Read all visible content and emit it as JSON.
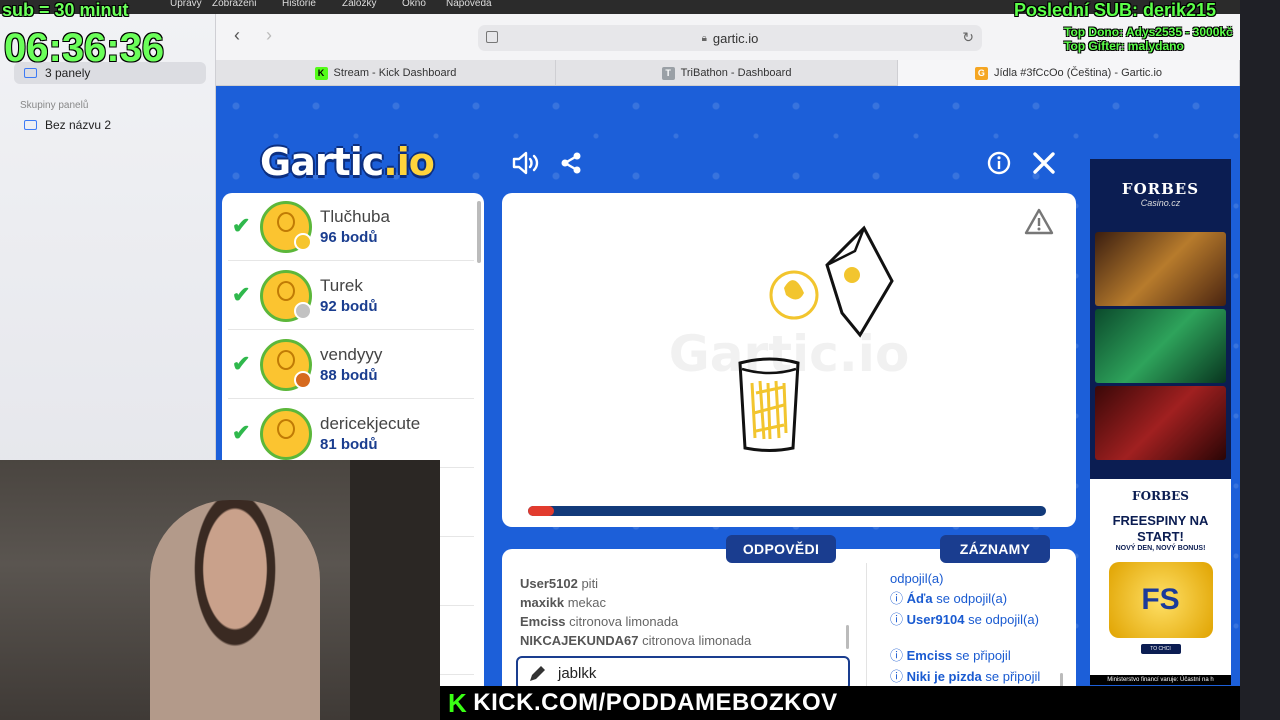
{
  "overlay": {
    "sub_rule": "sub = 30 minut",
    "timer": "06:36:36",
    "last_sub": "Poslední SUB: derik215",
    "top_donor": "Top Dono: Adys2535 - 3000kč",
    "top_gifter": "Top Gifter: malydano",
    "channel_url": "KICK.COM/PODDAMEBOZKOV",
    "kick_logo": "K"
  },
  "menubar": {
    "items": [
      "Upravy",
      "Zobrazeni",
      "Historie",
      "Zalozky",
      "Okno",
      "Napoveda"
    ]
  },
  "browser": {
    "sidebar": {
      "current": "3 panely",
      "section_label": "Skupiny panelů",
      "groups": [
        "Bez názvu 2"
      ]
    },
    "url": "gartic.io",
    "back_icon": "chevron-left-icon",
    "forward_icon": "chevron-right-icon",
    "tabs": [
      {
        "title": "Stream - Kick Dashboard",
        "favicon": "K",
        "favicon_color": "#53fc18"
      },
      {
        "title": "TriBathon - Dashboard",
        "favicon": "T",
        "favicon_color": "#9aa0a6"
      },
      {
        "title": "Jídla #3fCcOo (Čeština) - Gartic.io",
        "favicon": "G",
        "favicon_color": "#f5a623"
      }
    ]
  },
  "gartic": {
    "logo_main": "Gartic",
    "logo_suffix": ".io",
    "players": [
      {
        "name": "Tlučhuba",
        "score": "96 bodů",
        "medal": "#f6c52c"
      },
      {
        "name": "Turek",
        "score": "92 bodů",
        "medal": "#c2c2c2"
      },
      {
        "name": "vendyyy",
        "score": "88 bodů",
        "medal": "#d66a1f"
      },
      {
        "name": "dericekjecute",
        "score": "81 bodů",
        "medal": ""
      }
    ],
    "answers_label": "ODPOVĚDI",
    "records_label": "ZÁZNAMY",
    "answers": [
      {
        "user": "User5102",
        "text": "piti"
      },
      {
        "user": "maxikk",
        "text": "mekac"
      },
      {
        "user": "Emciss",
        "text": "citronova limonada"
      },
      {
        "user": "NIKCAJEKUNDA67",
        "text": "citronova limonada"
      }
    ],
    "guess_value": "jablkk",
    "log": [
      {
        "name": "",
        "text": "odpojil(a)"
      },
      {
        "name": "Áďa",
        "text": "se odpojil(a)"
      },
      {
        "name": "User9104",
        "text": "se odpojil(a)"
      },
      {
        "name": "Emciss",
        "text": "se připojil"
      },
      {
        "name": "Niki je pizda",
        "text": "se připojil"
      }
    ],
    "timer_progress": 0.05,
    "accent": "#1a3d8f",
    "background": "#1c5fd9"
  },
  "ad": {
    "brand": "FORBES",
    "brand_sub": "Casino.cz",
    "footer_brand": "FORBES",
    "headline": "FREESPINY NA START!",
    "subline": "NOVÝ DEN, NOVÝ BONUS!",
    "badge": "FS",
    "cta": "TO CHCI",
    "disclaimer": "Ministerstvo financí varuje: Účastní na h"
  }
}
